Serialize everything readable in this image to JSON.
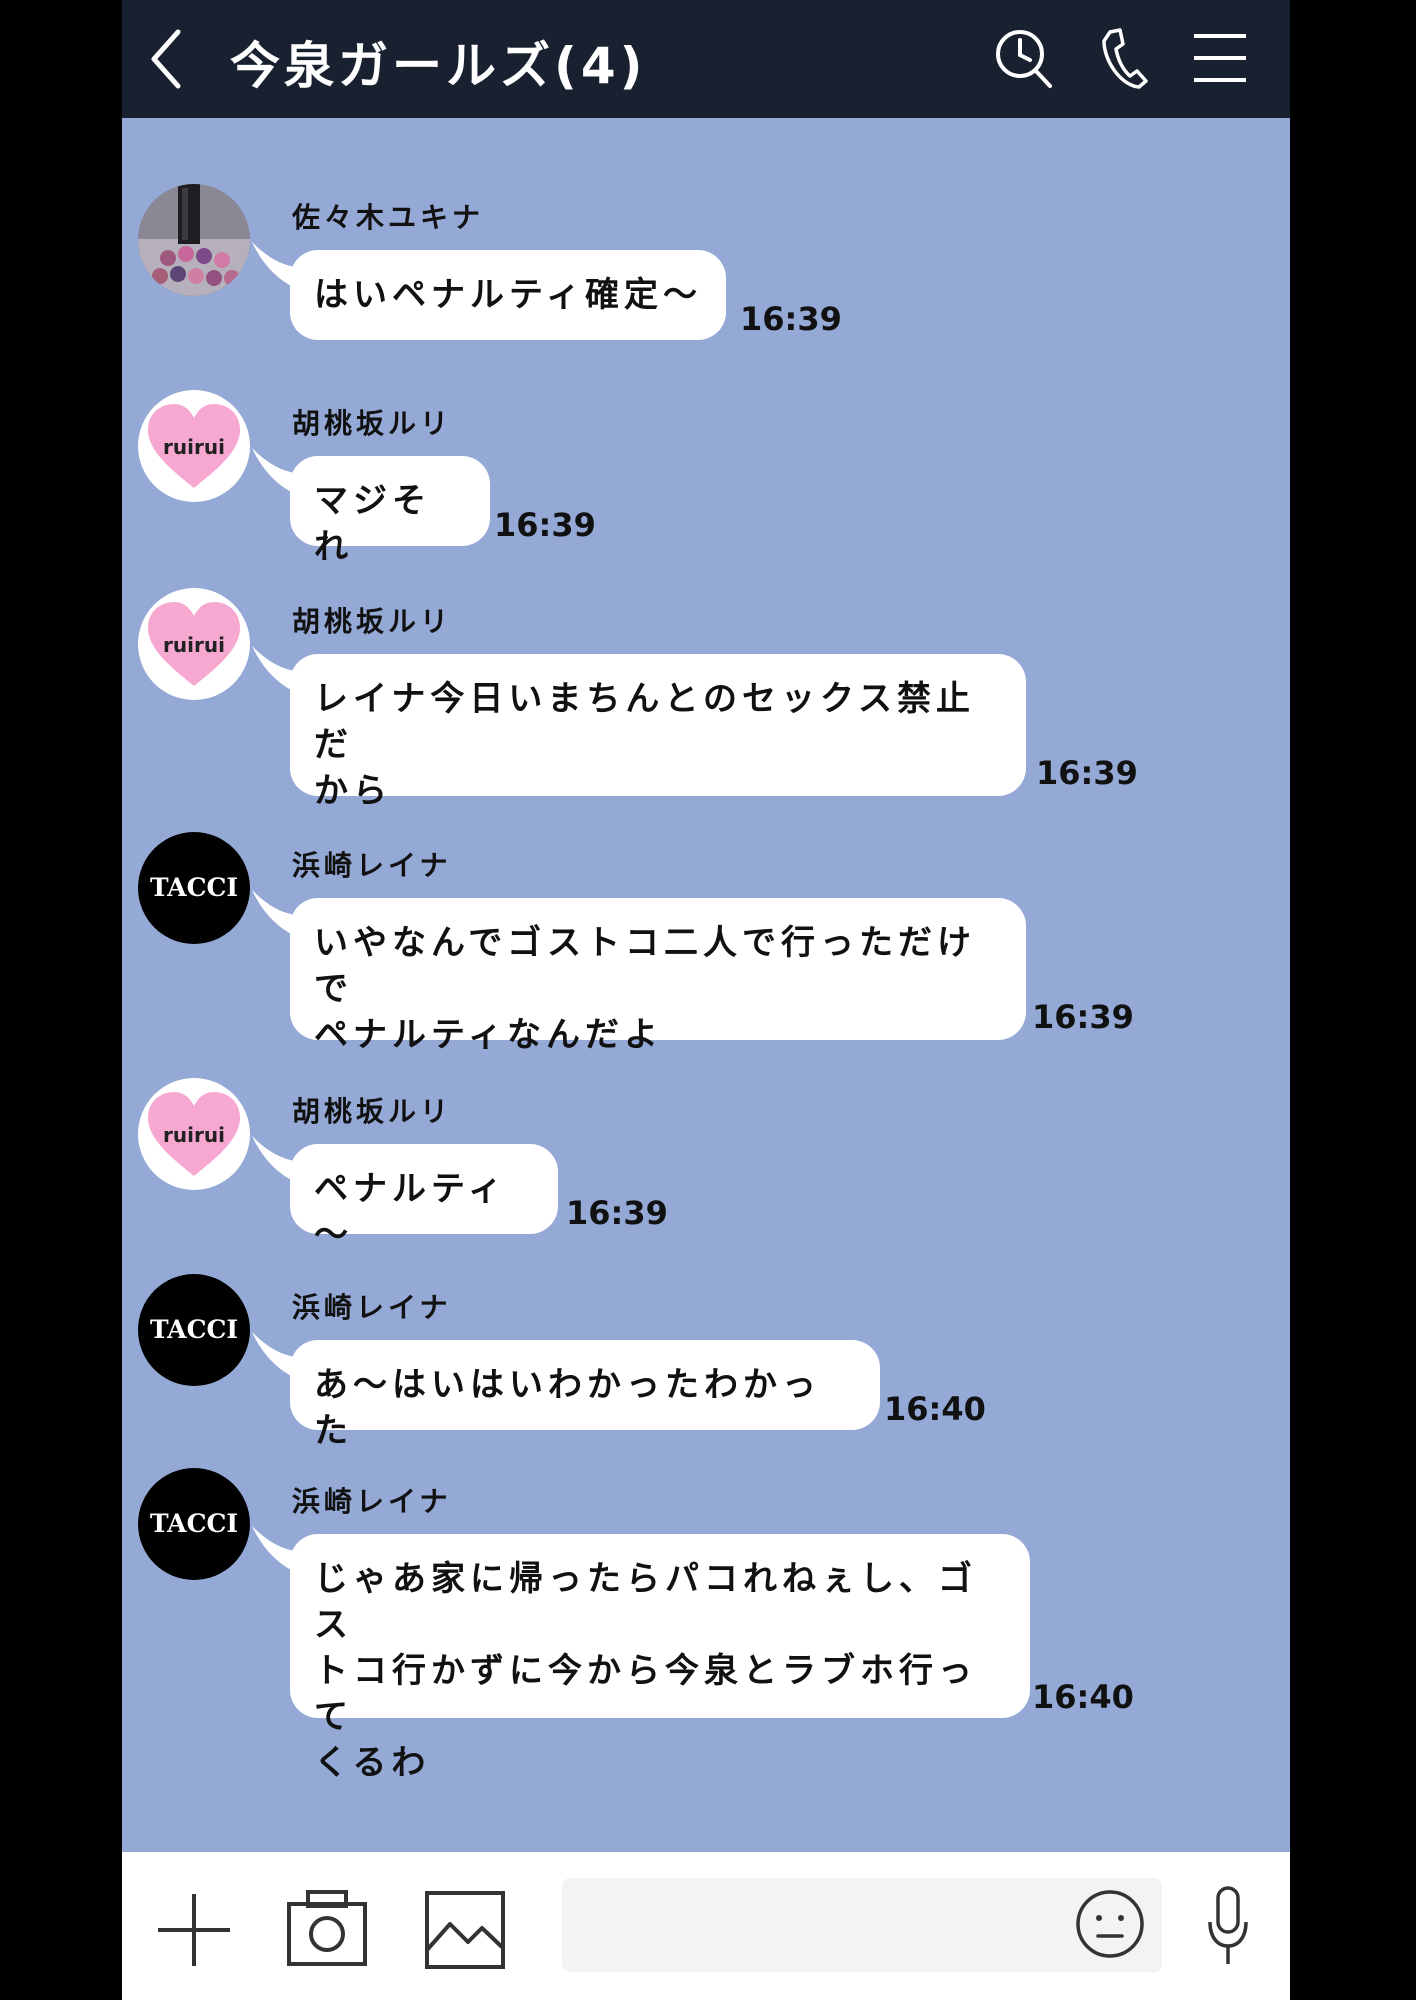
{
  "header": {
    "title": "今泉ガールズ(4)",
    "icons": [
      "back-icon",
      "clock-search-icon",
      "phone-icon",
      "menu-icon"
    ]
  },
  "messages": [
    {
      "sender": "佐々木ユキナ",
      "avatar": "makeup-photo",
      "text": "はいペナルティ確定～",
      "time": "16:39"
    },
    {
      "sender": "胡桃坂ルリ",
      "avatar": "ruirui",
      "avatar_text": "ruirui",
      "text": "マジそれ",
      "time": "16:39"
    },
    {
      "sender": "胡桃坂ルリ",
      "avatar": "ruirui",
      "avatar_text": "ruirui",
      "lines": [
        "レイナ今日いまちんとのセックス禁止だ",
        "から"
      ],
      "time": "16:39"
    },
    {
      "sender": "浜崎レイナ",
      "avatar": "tacci",
      "avatar_text": "TACCI",
      "lines": [
        "いやなんでゴストコ二人で行っただけで",
        "ペナルティなんだよ"
      ],
      "time": "16:39"
    },
    {
      "sender": "胡桃坂ルリ",
      "avatar": "ruirui",
      "avatar_text": "ruirui",
      "text": "ペナルティ～",
      "time": "16:39"
    },
    {
      "sender": "浜崎レイナ",
      "avatar": "tacci",
      "avatar_text": "TACCI",
      "text": "あ～はいはいわかったわかった",
      "time": "16:40"
    },
    {
      "sender": "浜崎レイナ",
      "avatar": "tacci",
      "avatar_text": "TACCI",
      "lines": [
        "じゃあ家に帰ったらパコれねぇし、ゴス",
        "トコ行かずに今から今泉とラブホ行って",
        "くるわ"
      ],
      "time": "16:40"
    }
  ],
  "footer": {
    "icons": [
      "plus-icon",
      "camera-icon",
      "image-icon",
      "emoji-icon",
      "microphone-icon"
    ],
    "input_value": ""
  },
  "colors": {
    "header_bg": "#192131",
    "chat_bg": "#94a9d6",
    "bubble_bg": "#ffffff",
    "heart_pink": "#f7a8d1"
  }
}
